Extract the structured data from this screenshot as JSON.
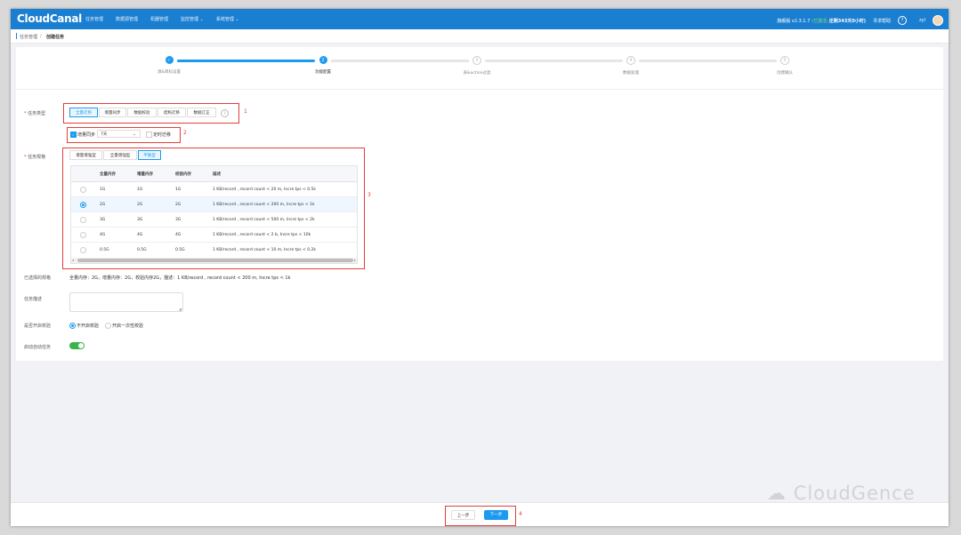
{
  "header": {
    "logo": "CloudCanal",
    "nav": [
      "任务管理",
      "数据源管理",
      "机器管理",
      "监控管理 ⌄",
      "系统管理 ⌄"
    ],
    "version": "旗舰版 v2.3.1.7",
    "status_label": "(已激活,",
    "expire": "还剩343天0小时)",
    "help": "寻求帮助",
    "user": "zyl"
  },
  "breadcrumb": {
    "parent": "任务管理",
    "current": "创建任务"
  },
  "steps": [
    {
      "label": "源&目标设置",
      "state": "done",
      "num": "✓"
    },
    {
      "label": "功能配置",
      "state": "current",
      "num": "2"
    },
    {
      "label": "表&action过滤",
      "state": "todo",
      "num": "3"
    },
    {
      "label": "数据处理",
      "state": "todo",
      "num": "4"
    },
    {
      "label": "创建确认",
      "state": "todo",
      "num": "5"
    }
  ],
  "form": {
    "task_type_label": "任务类型",
    "task_types": [
      "全量迁移",
      "增量同步",
      "数据校验",
      "结构迁移",
      "数据订正"
    ],
    "task_type_selected": 0,
    "incr_sync_label": "增量同步",
    "incr_sync_option": "7天",
    "timed_migration_label": "定时迁移",
    "spec_label": "任务规格",
    "spec_tabs": [
      "增量增强型",
      "全量增强型",
      "平衡型"
    ],
    "spec_tab_selected": 2,
    "selected_spec_label": "已选择的规格",
    "selected_spec_text": "全量内存：2G，增量内存：2G，校验内存2G，描述：1 KB/record , record count < 200 m, Incre tps < 1k",
    "desc_label": "任务描述",
    "verify_label": "是否开启校验",
    "verify_options": [
      "不开启校验",
      "开启一次性校验"
    ],
    "autostart_label": "启动自动任务"
  },
  "spec_table": {
    "headers": [
      "全量内存",
      "增量内存",
      "校验内存",
      "描述"
    ],
    "rows": [
      [
        "1G",
        "1G",
        "1G",
        "1 KB/record , record count < 20 m, Incre tps < 0.5k"
      ],
      [
        "2G",
        "2G",
        "2G",
        "1 KB/record , record count < 200 m, Incre tps < 1k"
      ],
      [
        "3G",
        "3G",
        "3G",
        "1 KB/record , record count < 500 m, Incre tps < 2k"
      ],
      [
        "4G",
        "4G",
        "4G",
        "1 KB/record , record count < 2 b, Incre tps < 10k"
      ],
      [
        "0.5G",
        "0.5G",
        "0.5G",
        "1 KB/record , record count < 10 m, Incre tps < 0.2k"
      ]
    ],
    "selected_row": 1
  },
  "annotations": [
    "1",
    "2",
    "3",
    "4"
  ],
  "footer": {
    "prev": "上一步",
    "next": "下一步"
  },
  "watermark": "CloudGence"
}
